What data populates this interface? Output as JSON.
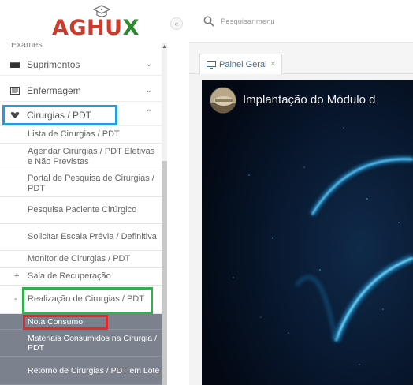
{
  "app": {
    "logo_text_main": "AGHU",
    "logo_text_x": "X"
  },
  "search": {
    "placeholder": "Pesquisar menu"
  },
  "sidebar": {
    "top_cut_label": "Exames",
    "menu": [
      {
        "label": "Suprimentos",
        "icon": "box-icon",
        "state": "collapsed"
      },
      {
        "label": "Enfermagem",
        "icon": "clipboard-icon",
        "state": "collapsed"
      },
      {
        "label": "Cirurgias / PDT",
        "icon": "heart-icon",
        "state": "expanded"
      }
    ],
    "sub_items": [
      {
        "label": "Lista de Cirurgias / PDT"
      },
      {
        "label": "Agendar Cirurgias / PDT Eletivas e Não Previstas"
      },
      {
        "label": "Portal de Pesquisa de Cirurgias / PDT"
      },
      {
        "label": "Pesquisa Paciente Cirúrgico"
      },
      {
        "label": "Solicitar Escala Prévia / Definitiva"
      },
      {
        "label": "Monitor de Cirurgias / PDT"
      },
      {
        "label": "Sala de Recuperação",
        "prefix": "+"
      },
      {
        "label": "Realização de Cirurgias / PDT",
        "prefix": "-"
      }
    ],
    "dark_items": [
      {
        "label": "Nota Consumo"
      },
      {
        "label": "Materiais Consumidos na Cirurgia / PDT"
      },
      {
        "label": "Retorno de Cirurgias / PDT em Lote"
      }
    ]
  },
  "tabs": [
    {
      "label": "Painel Geral",
      "close": "×",
      "icon": "monitor-icon"
    }
  ],
  "video": {
    "title": "Implantação do Módulo d"
  },
  "colors": {
    "highlight_blue": "#1e9fe0",
    "highlight_green": "#2db34a",
    "highlight_red": "#e02b2b",
    "logo_red": "#d03a2b",
    "logo_green": "#2a8a2f",
    "dark_menu_bg": "#7b828e"
  }
}
